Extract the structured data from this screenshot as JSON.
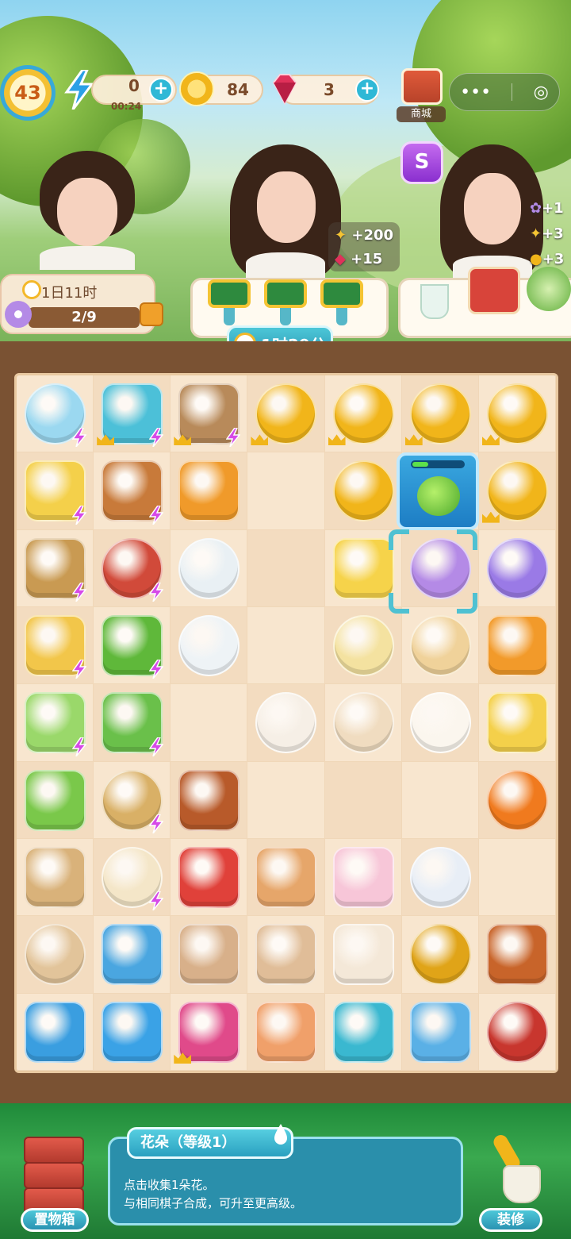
{
  "hud": {
    "level": "43",
    "energy": "0",
    "energy_timer": "00:24",
    "coins": "84",
    "gems": "3",
    "shop_label": "商城",
    "capsule_more": "•••",
    "capsule_target": "◎",
    "purple_btn": "S"
  },
  "order": {
    "time_left": "1日11时",
    "progress": "2/9"
  },
  "rewards": {
    "wheat": "+200",
    "gem": "+15",
    "right_1": "+1",
    "right_2": "+3",
    "right_3": "+3"
  },
  "timer": "1时29分",
  "board": {
    "columns": 7,
    "rows": 9,
    "cells": [
      [
        "fishbowl",
        "doghouse",
        "toolbox",
        "coins",
        "coins",
        "coins",
        "coins"
      ],
      [
        "bucket",
        "cherry-basket",
        "fan",
        "",
        "coin-stack",
        "pufferfish",
        "coins"
      ],
      [
        "corn-basket",
        "cherry-bowl",
        "lemon-tea",
        "",
        "cake-slice",
        "flower",
        "flower-pot"
      ],
      [
        "juicer",
        "vegetable-basket",
        "tea-cup",
        "",
        "tofu-flower",
        "flower-cake",
        "orange-jelly"
      ],
      [
        "juice-blender",
        "coffee-machine",
        "",
        "bun",
        "sesame-bun",
        "mantou",
        "pineapple-cake"
      ],
      [
        "citrus-juicer",
        "pot",
        "roast-meat",
        "",
        "",
        "",
        "persimmon"
      ],
      [
        "spatula",
        "soup-bowl",
        "watermelon",
        "pizza",
        "ice-cream",
        "teapot",
        ""
      ],
      [
        "pan",
        "fridge",
        "paper-bag",
        "paper-bag-2",
        "fried-rice",
        "coin-rope",
        "roast-chicken"
      ],
      [
        "ice-box",
        "fridge-2",
        "dragon-fruit",
        "bone",
        "pet-collar",
        "pet-food",
        "pomegranate"
      ]
    ]
  },
  "info": {
    "title": "花朵（等级1）",
    "line1": "点击收集1朵花。",
    "line2": "与相同棋子合成，可升至更高级。"
  },
  "buttons": {
    "storage": "置物箱",
    "decorate": "装修"
  },
  "colors": {
    "accent": "#2fb8d6",
    "board": "#f8e6cf",
    "frame": "#7a5233",
    "bottom": "#2a9a45"
  }
}
